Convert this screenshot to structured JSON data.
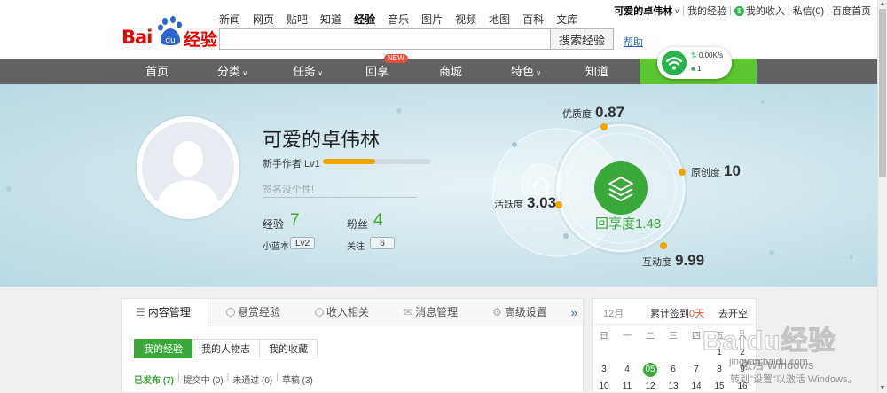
{
  "logo": {
    "bai": "Bai",
    "du": "du",
    "jingyan": "经验"
  },
  "channels": [
    "新闻",
    "网页",
    "贴吧",
    "知道",
    "经验",
    "音乐",
    "图片",
    "视频",
    "地图",
    "百科",
    "文库"
  ],
  "active_channel": "经验",
  "search": {
    "placeholder": "",
    "button": "搜索经验",
    "help": "帮助"
  },
  "userbar": {
    "username": "可爱的卓伟林",
    "my_exp": "我的经验",
    "my_income": "我的收入",
    "messages": "私信(0)",
    "home": "百度首页"
  },
  "nav": {
    "items": [
      "首页",
      "分类",
      "任务",
      "回享",
      "商城",
      "特色",
      "知道"
    ],
    "badge": "NEW"
  },
  "net_widget": {
    "speed": "0.00K/s",
    "count": "1"
  },
  "profile": {
    "name": "可爱的卓伟林",
    "level_label": "新手作者 Lv1",
    "level_progress": 0.48,
    "signature_placeholder": "签名没个性!",
    "exp_label": "经验",
    "exp_value": "7",
    "fans_label": "粉丝",
    "fans_value": "4",
    "blue_label": "小蓝本",
    "blue_value": "Lv2",
    "follow_label": "关注",
    "follow_value": "6"
  },
  "metrics": {
    "quality": {
      "label": "优质度",
      "value": "0.87"
    },
    "originality": {
      "label": "原创度",
      "value": "10"
    },
    "activity": {
      "label": "活跃度",
      "value": "3.03"
    },
    "interaction": {
      "label": "互动度",
      "value": "9.99"
    },
    "share": {
      "label": "回享度",
      "value": "1.48"
    }
  },
  "content": {
    "tabs": [
      "内容管理",
      "悬赏经验",
      "收入相关",
      "消息管理",
      "高级设置"
    ],
    "more": "»",
    "subtabs": [
      "我的经验",
      "我的人物志",
      "我的收藏"
    ],
    "filters": [
      "已发布 (7)",
      "提交中 (0)",
      "未通过 (0)",
      "草稿 (3)"
    ]
  },
  "calendar": {
    "month": "12月",
    "signed_prefix": "累计签到",
    "signed_days": "0天",
    "last_month": "去开空",
    "weekdays": [
      "日",
      "一",
      "二",
      "三",
      "四",
      "五",
      "六"
    ],
    "rows": [
      [
        "",
        "",
        "",
        "",
        "",
        "1",
        "2"
      ],
      [
        "3",
        "4",
        "05",
        "6",
        "7",
        "8",
        "9"
      ],
      [
        "10",
        "11",
        "12",
        "13",
        "14",
        "15",
        "16"
      ]
    ],
    "today": "05"
  },
  "watermark": {
    "text": "Baidu经验",
    "url": "jingyan.baidu.com"
  },
  "activation": {
    "line1": "激活 Windows",
    "line2": "转到\"设置\"以激活 Windows。"
  }
}
